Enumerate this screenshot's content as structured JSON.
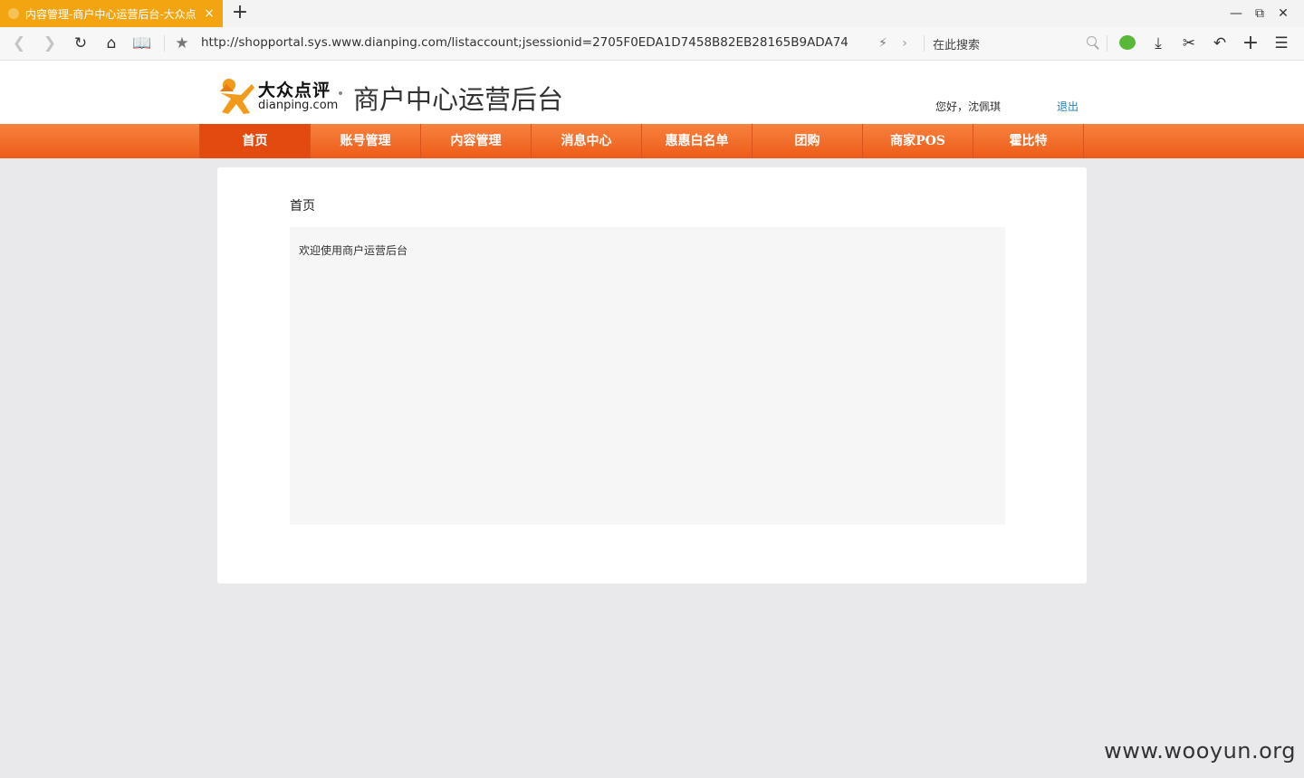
{
  "browser": {
    "tab_title": "内容管理-商户中心运营后台-大众点",
    "tab_close": "×",
    "new_tab": "+",
    "url": "http://shopportal.sys.www.dianping.com/listaccount;jsessionid=2705F0EDA1D7458B82EB28165B9ADA74",
    "search_placeholder": "在此搜索"
  },
  "header": {
    "logo_cn": "大众点评",
    "logo_en": "dianping.com",
    "site_title": "商户中心运营后台",
    "greeting": "您好，沈佩琪",
    "logout": "退出"
  },
  "nav": [
    {
      "label": "首页",
      "active": true
    },
    {
      "label": "账号管理",
      "active": false
    },
    {
      "label": "内容管理",
      "active": false
    },
    {
      "label": "消息中心",
      "active": false
    },
    {
      "label": "惠惠白名单",
      "active": false
    },
    {
      "label": "团购",
      "active": false
    },
    {
      "label": "商家POS",
      "active": false
    },
    {
      "label": "霍比特",
      "active": false
    }
  ],
  "main": {
    "heading": "首页",
    "welcome": "欢迎使用商户运营后台"
  },
  "watermark": "www.wooyun.org",
  "colors": {
    "tab_bg": "#f2a511",
    "nav_bg": "#ee5b19",
    "nav_active": "#e24a10",
    "link": "#1f7fc1",
    "page_bg": "#e9e9ec"
  }
}
